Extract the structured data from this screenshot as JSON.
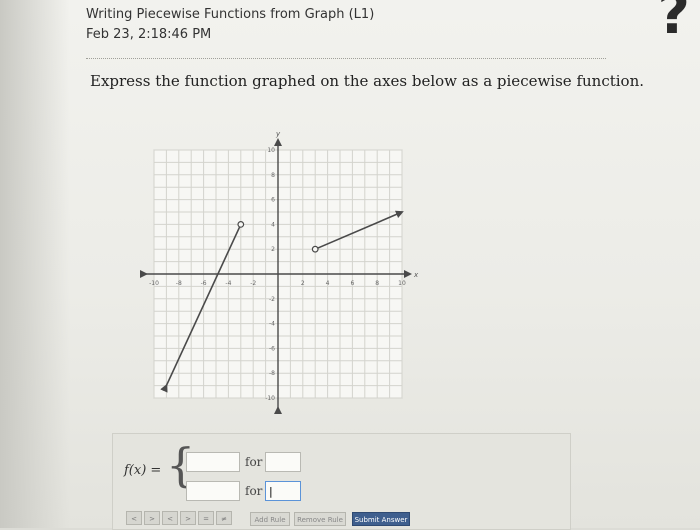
{
  "header": {
    "title": "Writing Piecewise Functions from Graph (L1)",
    "timestamp": "Feb 23, 2:18:46 PM",
    "help": "?"
  },
  "question": {
    "prompt": "Express the function graphed on the axes below as a piecewise function."
  },
  "chart_data": {
    "type": "line",
    "title": "",
    "xlabel": "x",
    "ylabel": "y",
    "xlim": [
      -10,
      10
    ],
    "ylim": [
      -10,
      10
    ],
    "grid": true,
    "x_ticks": [
      "-10",
      "-8",
      "-6",
      "-4",
      "-2",
      "2",
      "4",
      "6",
      "8",
      "10"
    ],
    "y_ticks": [
      "10",
      "8",
      "6",
      "4",
      "2",
      "-2",
      "-4",
      "-6",
      "-8",
      "-10"
    ],
    "series": [
      {
        "x": [
          -9,
          -3
        ],
        "y": [
          -9,
          4
        ],
        "start_endpoint": "arrow",
        "end_endpoint": "open"
      },
      {
        "x": [
          3,
          10
        ],
        "y": [
          2,
          5
        ],
        "start_endpoint": "open",
        "end_endpoint": "arrow"
      }
    ]
  },
  "answer": {
    "function_label": "f(x) =",
    "pieces": [
      {
        "expression": "",
        "for_label": "for",
        "condition": ""
      },
      {
        "expression": "",
        "for_label": "for",
        "condition": "|"
      }
    ]
  },
  "toolbar": {
    "buttons": [
      "<",
      ">",
      "<",
      ">",
      "=",
      "≠"
    ],
    "add_rule": "Add Rule",
    "remove_rule": "Remove Rule",
    "submit": "Submit Answer"
  }
}
